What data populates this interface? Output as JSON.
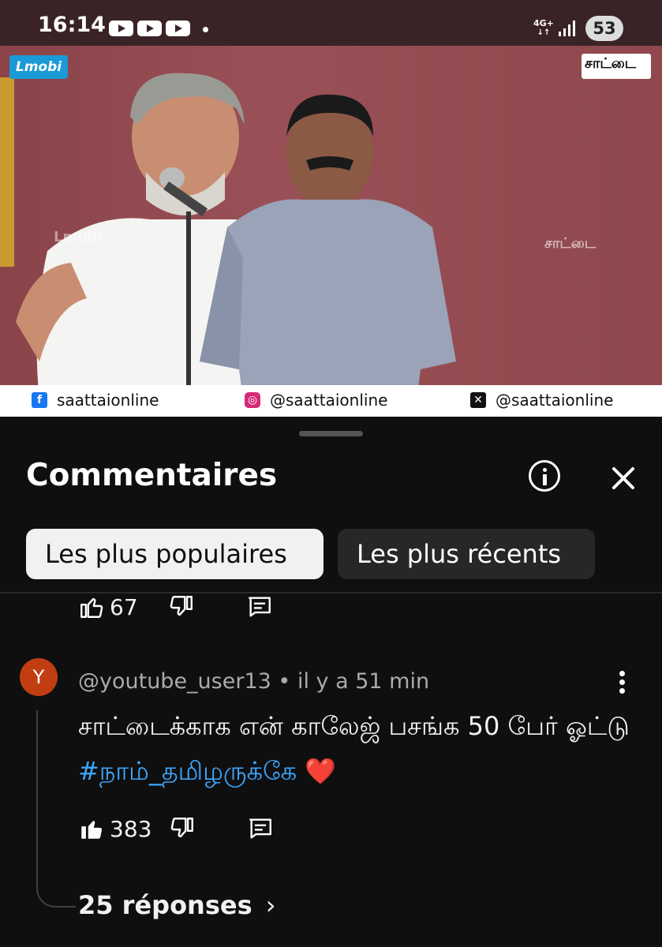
{
  "status_bar": {
    "time": "16:14",
    "network": "4G+",
    "battery": "53"
  },
  "video": {
    "logo_left": "Lmobi",
    "logo_right": "சாட்டை",
    "watermark_left": "Lmobi",
    "watermark_right": "சாட்டை",
    "social": {
      "facebook": "saattaionline",
      "instagram": "@saattaionline",
      "x": "@saattaionline"
    },
    "colors": {
      "background": "#8e4a4e",
      "facebook": "#1877f2",
      "instagram": "#d62976",
      "x": "#111111"
    }
  },
  "comments_panel": {
    "title": "Commentaires",
    "filters": [
      {
        "label": "Les plus populaires",
        "active": true
      },
      {
        "label": "Les plus récents",
        "active": false
      }
    ],
    "previous_comment": {
      "likes": "67"
    },
    "comment": {
      "avatar_letter": "Y",
      "avatar_color": "#c13e12",
      "author": "@youtube_user13",
      "separator": "•",
      "time": "il y a 51 min",
      "text_plain": "சாட்டைக்காக என் காலேஜ் பசங்க 50 பேர் ஓட்டு ",
      "hashtag": "#நாம்_தமிழருக்கே",
      "emoji": "❤️",
      "likes": "383",
      "replies": "25 réponses"
    }
  }
}
